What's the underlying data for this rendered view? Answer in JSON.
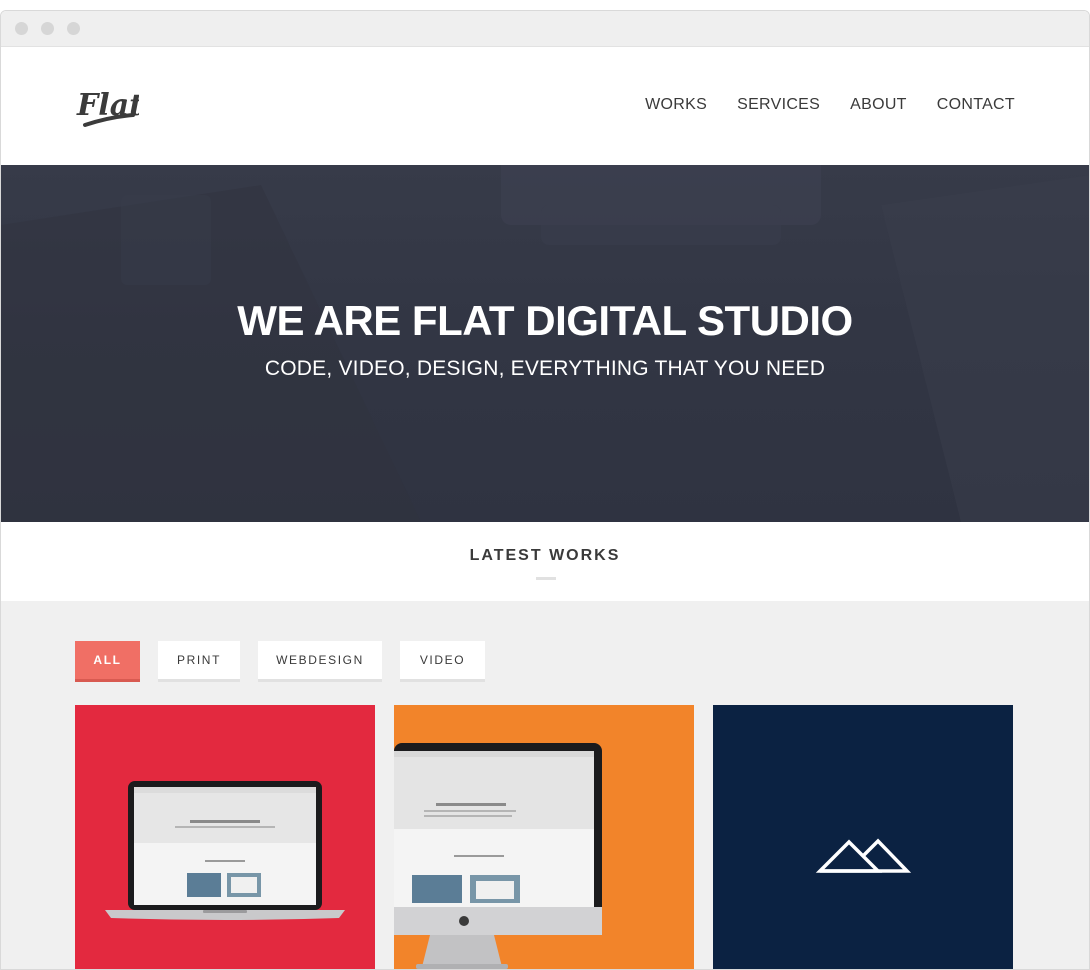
{
  "logo": {
    "text": "Flat",
    "icon": "flat-logo-icon"
  },
  "nav": {
    "items": [
      {
        "label": "WORKS"
      },
      {
        "label": "SERVICES"
      },
      {
        "label": "ABOUT"
      },
      {
        "label": "CONTACT"
      }
    ]
  },
  "hero": {
    "title": "WE ARE FLAT DIGITAL STUDIO",
    "subtitle": "CODE, VIDEO, DESIGN, EVERYTHING THAT YOU NEED"
  },
  "latest_works": {
    "title": "LATEST WORKS"
  },
  "filters": {
    "items": [
      {
        "label": "ALL",
        "active": true
      },
      {
        "label": "PRINT",
        "active": false
      },
      {
        "label": "WEBDESIGN",
        "active": false
      },
      {
        "label": "VIDEO",
        "active": false
      }
    ]
  },
  "tiles": [
    {
      "type": "laptop-mockup",
      "background": "#e3293f",
      "screen_heading": "Hello, I'm François Martin"
    },
    {
      "type": "imac-mockup",
      "background": "#f2842a",
      "screen_heading": "Hello, I'm François Martin"
    },
    {
      "type": "mountain-logo",
      "background": "#0b2242",
      "icon": "mountain-logo-icon"
    }
  ],
  "colors": {
    "accent": "#f06f65",
    "hero_bg": "#323644",
    "works_bg": "#f0f0f0"
  }
}
